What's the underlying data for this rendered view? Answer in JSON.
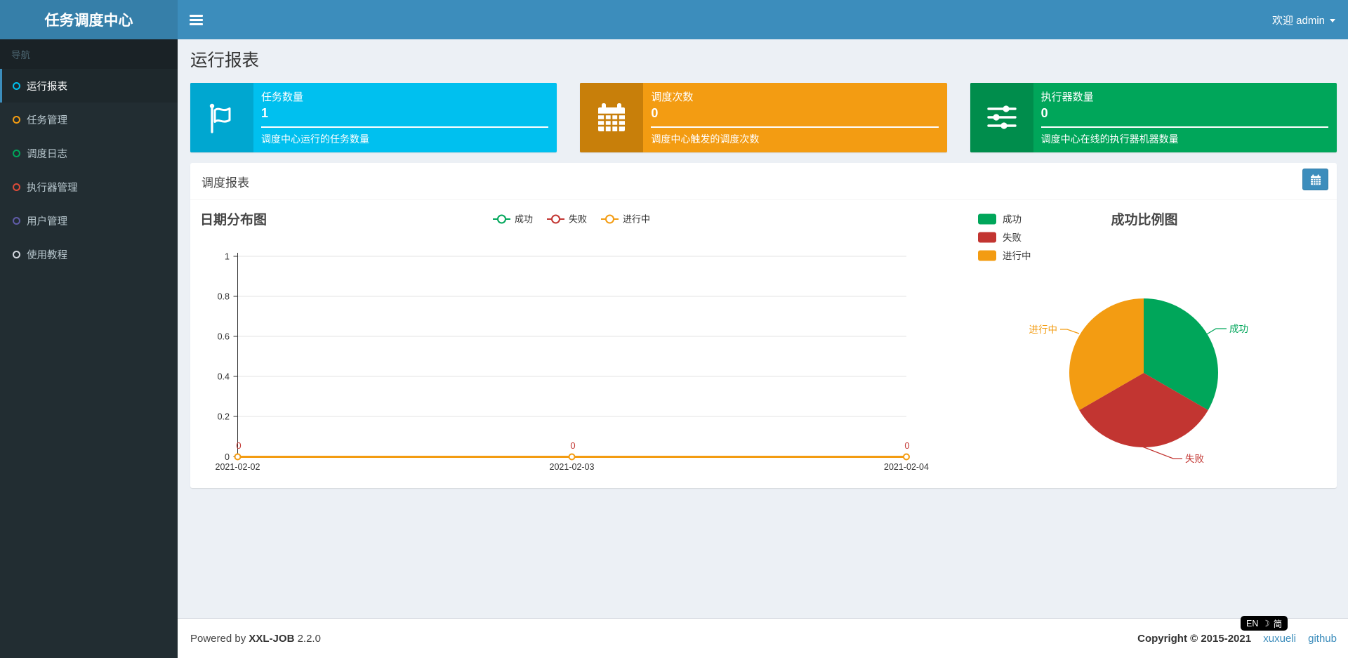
{
  "header": {
    "brand": "任务调度中心",
    "welcome": "欢迎 admin"
  },
  "sidebar": {
    "section_label": "导航",
    "items": [
      {
        "label": "运行报表",
        "color": "#00c0ef",
        "active": true
      },
      {
        "label": "任务管理",
        "color": "#f39c12",
        "active": false
      },
      {
        "label": "调度日志",
        "color": "#00a65a",
        "active": false
      },
      {
        "label": "执行器管理",
        "color": "#dd4b39",
        "active": false
      },
      {
        "label": "用户管理",
        "color": "#605ca8",
        "active": false
      },
      {
        "label": "使用教程",
        "color": "#d2d6de",
        "active": false
      }
    ]
  },
  "page": {
    "title": "运行报表"
  },
  "stat_cards": [
    {
      "title": "任务数量",
      "value": "1",
      "description": "调度中心运行的任务数量",
      "bg": "#00c0ef",
      "icon_bg": "#00a7d0",
      "icon": "flag-icon"
    },
    {
      "title": "调度次数",
      "value": "0",
      "description": "调度中心触发的调度次数",
      "bg": "#f39c12",
      "icon_bg": "#c87f0a",
      "icon": "calendar-icon"
    },
    {
      "title": "执行器数量",
      "value": "0",
      "description": "调度中心在线的执行器机器数量",
      "bg": "#00a65a",
      "icon_bg": "#008d4c",
      "icon": "sliders-icon"
    }
  ],
  "panel": {
    "title": "调度报表"
  },
  "chart_data": [
    {
      "type": "line",
      "title": "日期分布图",
      "x": [
        "2021-02-02",
        "2021-02-03",
        "2021-02-04"
      ],
      "series": [
        {
          "name": "成功",
          "color": "#00A65A",
          "values": [
            0,
            0,
            0
          ]
        },
        {
          "name": "失败",
          "color": "#C23531",
          "values": [
            0,
            0,
            0
          ]
        },
        {
          "name": "进行中",
          "color": "#F39C12",
          "values": [
            0,
            0,
            0
          ]
        }
      ],
      "ylim": [
        0,
        1
      ],
      "yticks": [
        "1",
        "0.8",
        "0.6",
        "0.4",
        "0.2",
        "0"
      ],
      "point_labels": [
        "0",
        "0",
        "0"
      ],
      "grid": true,
      "legend_position": "top-center"
    },
    {
      "type": "pie",
      "title": "成功比例图",
      "slices": [
        {
          "name": "成功",
          "value": 1,
          "color": "#00A65A"
        },
        {
          "name": "失败",
          "value": 1,
          "color": "#C23531"
        },
        {
          "name": "进行中",
          "value": 1,
          "color": "#F39C12"
        }
      ],
      "legend_position": "top-left"
    }
  ],
  "footer": {
    "powered_prefix": "Powered by",
    "product": "XXL-JOB",
    "version": "2.2.0",
    "copyright": "Copyright © 2015-2021",
    "links": [
      "xuxueli",
      "github"
    ]
  },
  "lang_widget": {
    "left": "EN",
    "moon": "☽",
    "right": "简"
  }
}
